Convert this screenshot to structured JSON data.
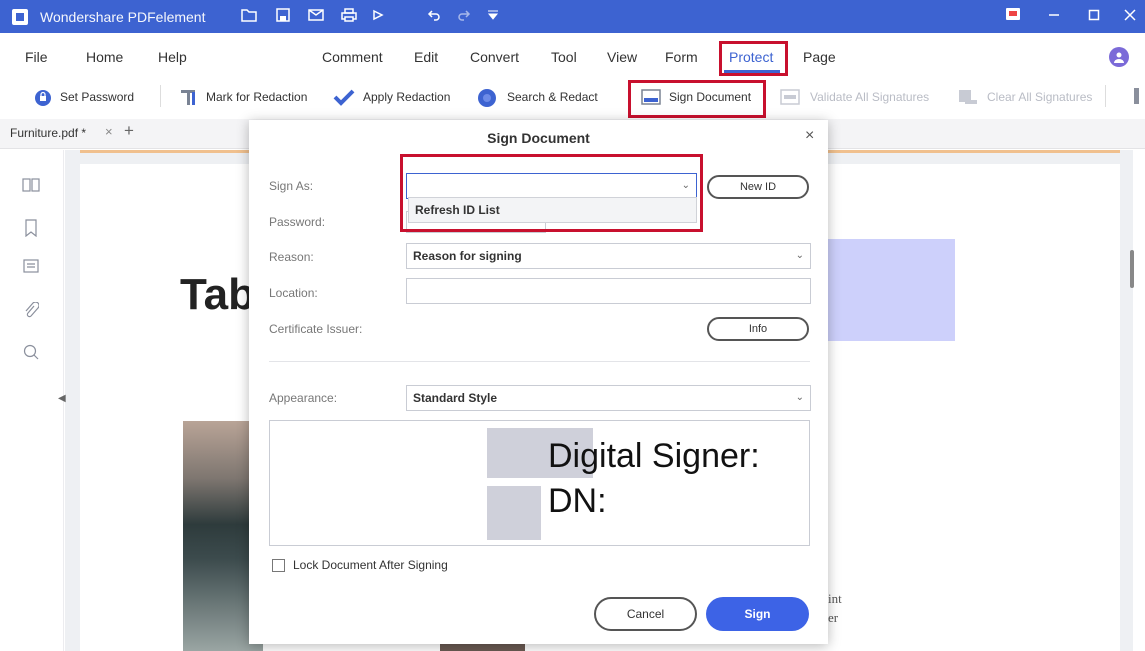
{
  "app": {
    "title": "Wondershare PDFelement"
  },
  "menu": {
    "items": [
      "File",
      "Home",
      "Help",
      "Comment",
      "Edit",
      "Convert",
      "Tool",
      "View",
      "Form",
      "Protect",
      "Page"
    ],
    "active": "Protect"
  },
  "toolbar": {
    "set_password": "Set Password",
    "mark_for_redaction": "Mark for Redaction",
    "apply_redaction": "Apply Redaction",
    "search_redact": "Search & Redact",
    "sign_document": "Sign Document",
    "validate_all": "Validate All Signatures",
    "clear_all": "Clear All Signatures"
  },
  "tabs": {
    "doc_name": "Furniture.pdf *",
    "close": "×",
    "add": "+"
  },
  "document": {
    "heading_fragment": "Tab",
    "text_fragment_1": "int",
    "text_fragment_2": "er"
  },
  "dialog": {
    "title": "Sign Document",
    "close": "×",
    "sign_as_label": "Sign As:",
    "sign_as_value": "",
    "dropdown_option": "Refresh ID List",
    "new_id_button": "New ID",
    "password_label": "Password:",
    "reason_label": "Reason:",
    "reason_value": "Reason for signing",
    "location_label": "Location:",
    "location_value": "",
    "cert_issuer_label": "Certificate Issuer:",
    "info_button": "Info",
    "appearance_label": "Appearance:",
    "appearance_value": "Standard Style",
    "preview_line1": "Digital Signer:",
    "preview_line2": "DN:",
    "lock_label": "Lock Document After Signing",
    "cancel": "Cancel",
    "sign": "Sign"
  },
  "colors": {
    "accent": "#3d63d1",
    "highlight": "#c8102e",
    "sign_button": "#3d63e6"
  },
  "icons": [
    "app-logo-icon",
    "folder-icon",
    "save-icon",
    "mail-icon",
    "print-icon",
    "share-icon",
    "undo-icon",
    "redo-icon",
    "dropdown-icon",
    "feedback-icon",
    "minimize-icon",
    "maximize-icon",
    "close-icon",
    "lock-icon",
    "redact-mark-icon",
    "check-icon",
    "search-icon",
    "signature-icon",
    "validate-icon",
    "clear-icon",
    "thumbnails-icon",
    "bookmark-icon",
    "comment-icon",
    "attachment-icon",
    "search-panel-icon"
  ]
}
